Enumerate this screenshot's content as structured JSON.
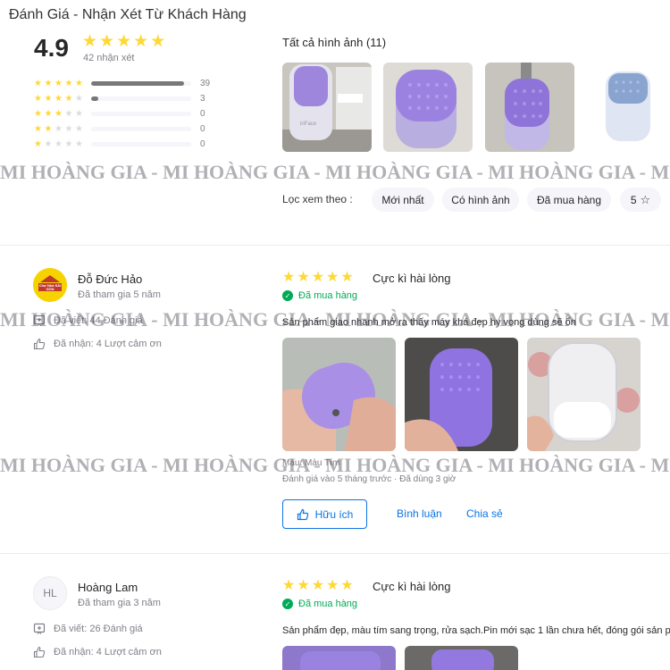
{
  "page": {
    "title": "Đánh Giá - Nhận Xét Từ Khách Hàng"
  },
  "summary": {
    "average": "4.9",
    "rating_value": 4.9,
    "total_label": "42 nhận xét",
    "distribution": [
      {
        "stars": 5,
        "count": "39",
        "fraction": 0.93
      },
      {
        "stars": 4,
        "count": "3",
        "fraction": 0.07
      },
      {
        "stars": 3,
        "count": "0",
        "fraction": 0
      },
      {
        "stars": 2,
        "count": "0",
        "fraction": 0
      },
      {
        "stars": 1,
        "count": "0",
        "fraction": 0
      }
    ]
  },
  "all_images": {
    "title": "Tất cả hình ảnh (11)"
  },
  "filter": {
    "label": "Lọc xem theo :",
    "chips": [
      "Mới nhất",
      "Có hình ảnh",
      "Đã mua hàng",
      "5"
    ]
  },
  "watermark": "MI HOÀNG GIA - MI HOÀNG GIA - MI HOÀNG GIA - MI HOÀNG GIA - MI HOÀNG GIA - MI HOÀNG GIA",
  "reviews": [
    {
      "name": "Đỗ Đức Hảo",
      "avatar_text": "Chợ Nhà SÀI GÒN",
      "joined": "Đã tham gia 5 năm",
      "written": "Đã viết: 44 Đánh giá",
      "received": "Đã nhận: 4 Lượt cảm ơn",
      "stars": 5,
      "title": "Cực kì hài lòng",
      "verified": "Đã mua hàng",
      "content": "Sản phẩm giao nhanh mở ra thấy máy khá đẹp hy vọng dùng sẽ ổn",
      "attribute": "Màu: Màu Tím",
      "meta": "Đánh giá vào 5 tháng trước · Đã dùng 3 giờ",
      "helpful_label": "Hữu ích",
      "comment_label": "Bình luận",
      "share_label": "Chia sẻ"
    },
    {
      "name": "Hoàng Lam",
      "avatar_text": "HL",
      "joined": "Đã tham gia 3 năm",
      "written": "Đã viết: 26 Đánh giá",
      "received": "Đã nhận: 4 Lượt cảm ơn",
      "stars": 5,
      "title": "Cực kì hài lòng",
      "verified": "Đã mua hàng",
      "content": "Sản phẩm đẹp, màu tím sang trọng, rửa sạch.Pin mới sạc 1 lần chưa hết, đóng gói sản phẩm cẩn thận"
    }
  ],
  "colors": {
    "star": "#fdd836",
    "star_off": "#dcdce0",
    "link": "#0b74e5",
    "verified": "#00ab56",
    "product_purple": "#9d86dc"
  }
}
